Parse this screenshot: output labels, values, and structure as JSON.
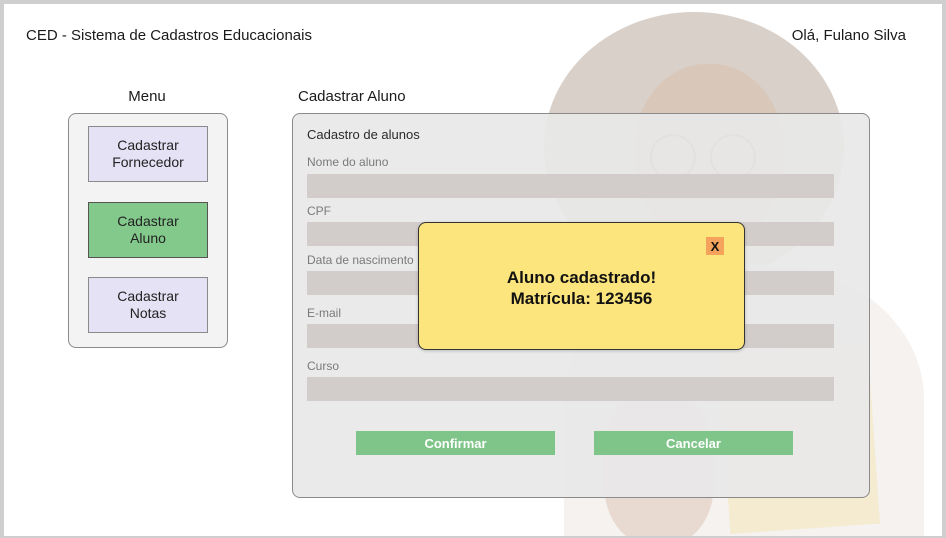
{
  "header": {
    "app_title": "CED - Sistema de Cadastros Educacionais",
    "greeting": "Olá, Fulano Silva"
  },
  "menu": {
    "title": "Menu",
    "items": [
      {
        "label": "Cadastrar\nFornecedor",
        "active": false
      },
      {
        "label": "Cadastrar\nAluno",
        "active": true
      },
      {
        "label": "Cadastrar\nNotas",
        "active": false
      }
    ]
  },
  "form": {
    "heading": "Cadastrar Aluno",
    "subtitle": "Cadastro de alunos",
    "fields": [
      {
        "label": "Nome do aluno",
        "value": ""
      },
      {
        "label": "CPF",
        "value": ""
      },
      {
        "label": "Data de nascimento",
        "value": ""
      },
      {
        "label": "E-mail",
        "value": ""
      },
      {
        "label": "Curso",
        "value": ""
      }
    ],
    "confirm_label": "Confirmar",
    "cancel_label": "Cancelar"
  },
  "dialog": {
    "close_label": "X",
    "line1": "Aluno cadastrado!",
    "line2": "Matrícula: 123456"
  },
  "colors": {
    "accent_green": "#83c98c",
    "menu_button": "#e4e2f4",
    "dialog_bg": "#fde57e",
    "close_button": "#f4a25c"
  }
}
